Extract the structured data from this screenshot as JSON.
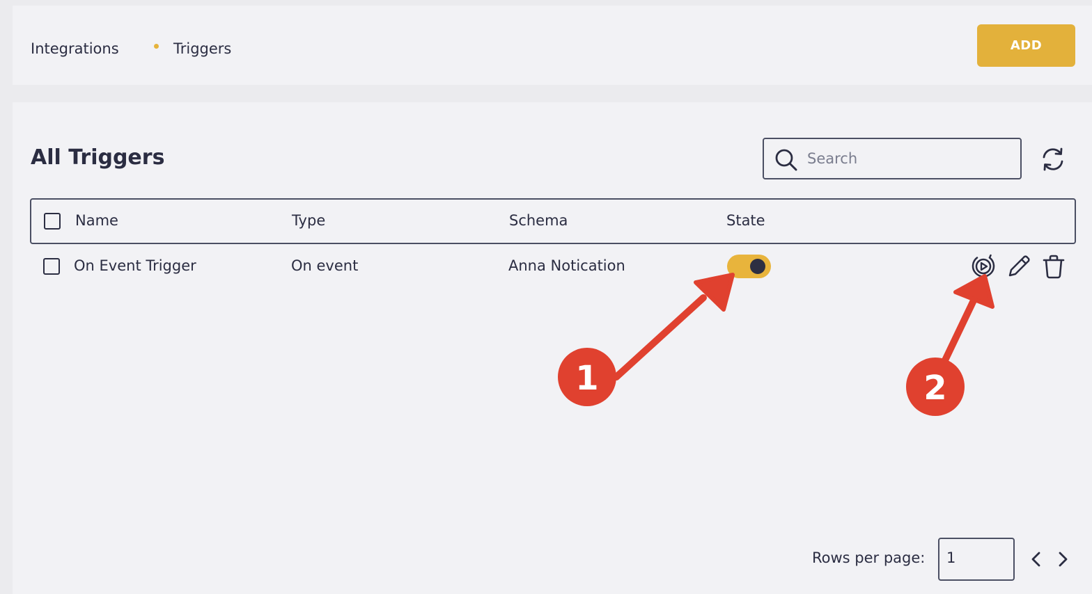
{
  "breadcrumb": {
    "items": [
      "Integrations",
      "Triggers"
    ]
  },
  "header": {
    "add_label": "ADD"
  },
  "main": {
    "title": "All Triggers",
    "search": {
      "placeholder": "Search",
      "value": ""
    },
    "table": {
      "columns": [
        "Name",
        "Type",
        "Schema",
        "State"
      ],
      "rows": [
        {
          "name": "On Event Trigger",
          "type": "On event",
          "schema": "Anna Notication",
          "state": "on"
        }
      ],
      "row_actions": [
        "run-icon",
        "edit-icon",
        "delete-icon"
      ]
    },
    "pagination": {
      "rows_per_page_label": "Rows per page:",
      "rows_per_page_value": "1"
    }
  },
  "annotations": {
    "callouts": [
      "1",
      "2"
    ],
    "color": "#e0412f"
  },
  "colors": {
    "accent": "#e3b13b",
    "text": "#2b2d42",
    "background": "#f2f2f5"
  }
}
